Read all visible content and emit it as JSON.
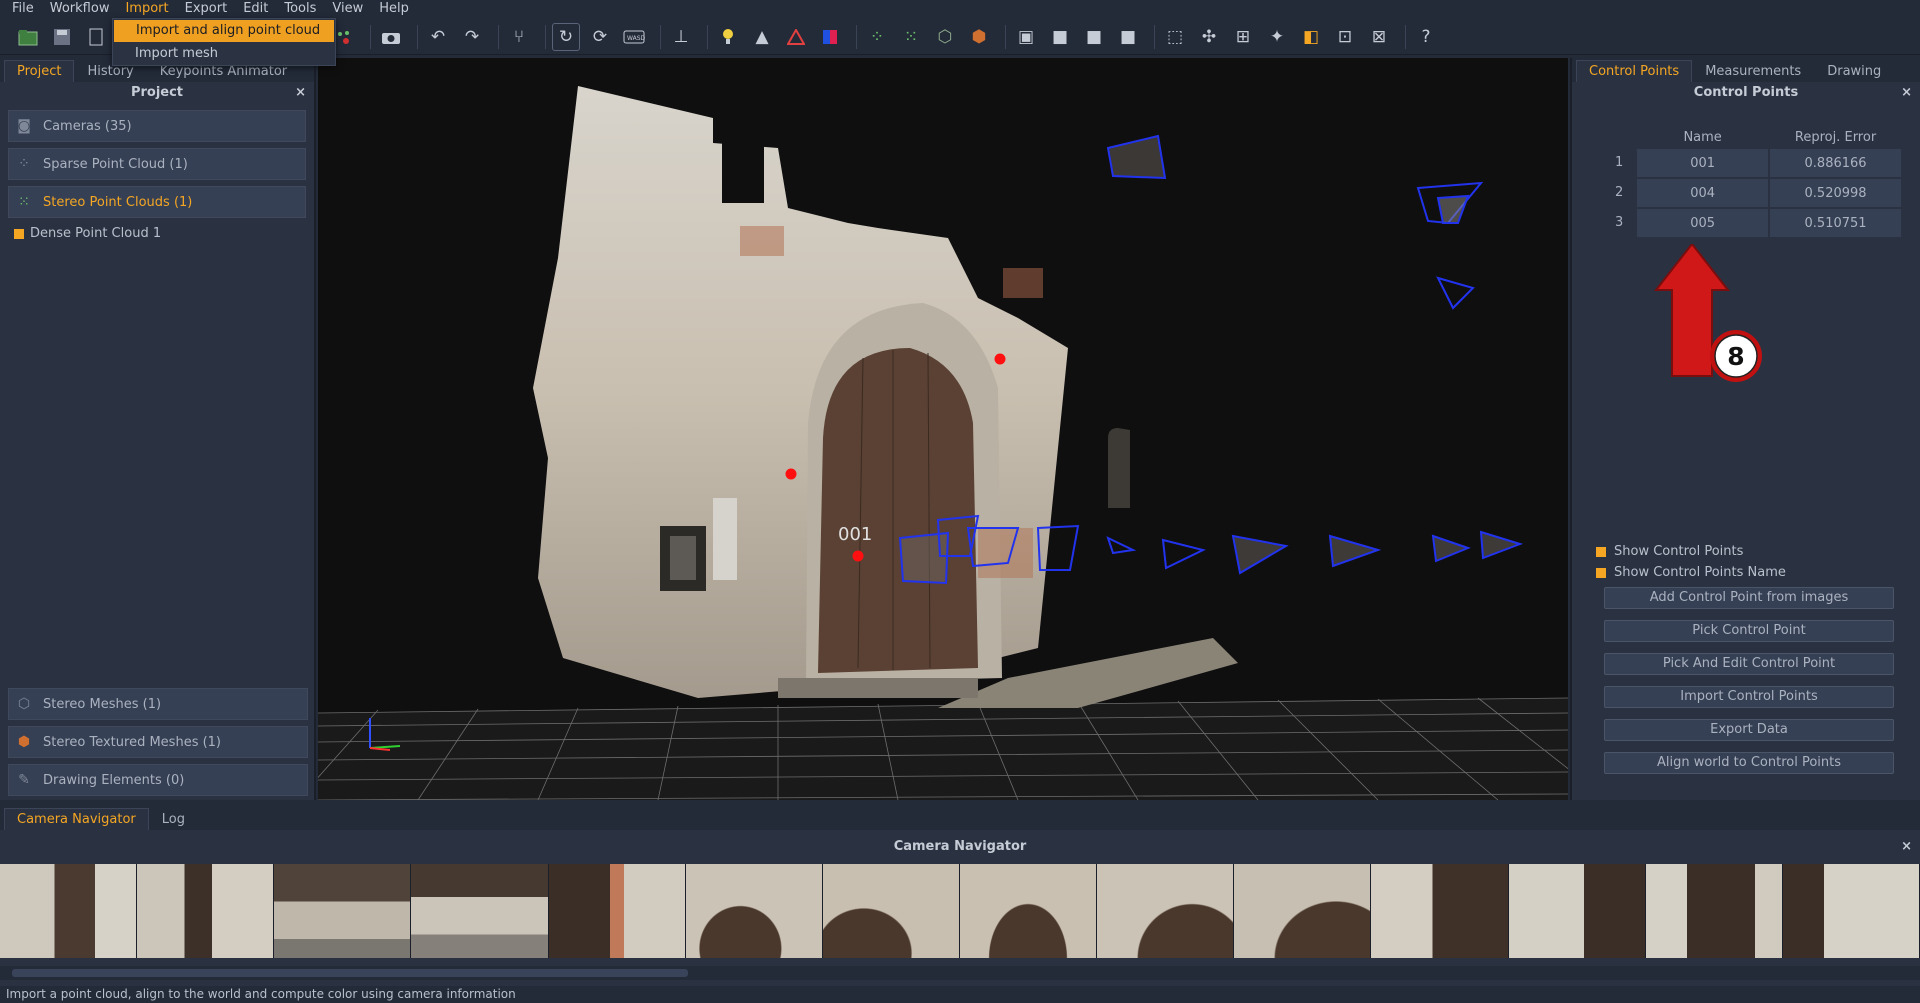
{
  "menubar": {
    "items": [
      "File",
      "Workflow",
      "Import",
      "Export",
      "Edit",
      "Tools",
      "View",
      "Help"
    ],
    "active": "Import"
  },
  "import_menu": {
    "items": [
      "Import and align point cloud",
      "Import mesh"
    ]
  },
  "toolbar": {
    "help_label": "?"
  },
  "left_panel": {
    "tabs": [
      "Project",
      "History",
      "Keypoints Animator"
    ],
    "title": "Project",
    "items": [
      {
        "label": "Cameras (35)",
        "icon": "camera-icon"
      },
      {
        "label": "Sparse Point Cloud (1)",
        "icon": "sparse-cloud-icon"
      },
      {
        "label": "Stereo Point Clouds (1)",
        "icon": "dense-cloud-icon"
      }
    ],
    "sub_items": [
      "Dense Point Cloud 1"
    ],
    "bottom_items": [
      {
        "label": "Stereo Meshes (1)",
        "icon": "mesh-icon"
      },
      {
        "label": "Stereo Textured Meshes (1)",
        "icon": "textured-mesh-icon"
      },
      {
        "label": "Drawing Elements (0)",
        "icon": "drawing-icon"
      }
    ]
  },
  "viewport": {
    "point_label": "001"
  },
  "right_panel": {
    "tabs": [
      "Control Points",
      "Measurements",
      "Drawing"
    ],
    "title": "Control Points",
    "table": {
      "headers": [
        "Name",
        "Reproj. Error"
      ],
      "rows": [
        {
          "index": "1",
          "name": "001",
          "error": "0.886166"
        },
        {
          "index": "2",
          "name": "004",
          "error": "0.520998"
        },
        {
          "index": "3",
          "name": "005",
          "error": "0.510751"
        }
      ]
    },
    "annotation_number": "8",
    "checkboxes": [
      "Show Control Points",
      "Show Control Points Name"
    ],
    "buttons": [
      "Add Control Point from images",
      "Pick Control Point",
      "Pick And Edit Control Point",
      "Import Control Points",
      "Export Data",
      "Align world to Control Points"
    ]
  },
  "bottom": {
    "tabs": [
      "Camera Navigator",
      "Log"
    ],
    "title": "Camera Navigator"
  },
  "statusbar": {
    "text": "Import a point cloud, align to the world and compute color using camera information"
  },
  "colors": {
    "accent": "#f5a623",
    "panel": "#2a3242",
    "control_point": "#ff1010",
    "camera_frustum": "#2233ee"
  }
}
